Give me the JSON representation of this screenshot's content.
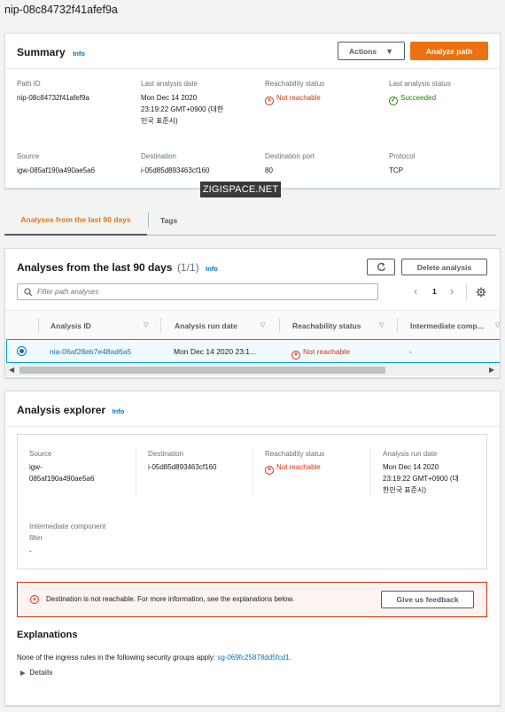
{
  "page_title": "nip-08c84732f41afef9a",
  "summary": {
    "title": "Summary",
    "info": "Info",
    "actions_label": "Actions",
    "analyze_label": "Analyze path",
    "path_id_label": "Path ID",
    "path_id": "nip-08c84732f41afef9a",
    "last_date_label": "Last analysis date",
    "last_date_l1": "Mon Dec 14 2020",
    "last_date_l2": "23:19:22 GMT+0900 (대한",
    "last_date_l3": "민국 표준시)",
    "reach_label": "Reachability status",
    "reach_value": "Not reachable",
    "last_status_label": "Last analysis status",
    "last_status_value": "Succeeded",
    "source_label": "Source",
    "source_value": "igw-085af190a490ae5a6",
    "dest_label": "Destination",
    "dest_value": "i-05d85d893463cf160",
    "port_label": "Destination port",
    "port_value": "80",
    "protocol_label": "Protocol",
    "protocol_value": "TCP"
  },
  "watermark": "ZIGISPACE.NET",
  "tabs": [
    "Analyses from the last 90 days",
    "Tags"
  ],
  "analyses": {
    "title": "Analyses from the last 90 days",
    "count": "(1/1)",
    "info": "Info",
    "delete_label": "Delete analysis",
    "filter_placeholder": "Filter path analyses",
    "page_number": "1",
    "columns": [
      "Analysis ID",
      "Analysis run date",
      "Reachability status",
      "Intermediate comp..."
    ],
    "row": {
      "id": "nia-06af28eb7e48ad6a5",
      "date": "Mon Dec 14 2020 23:1...",
      "status": "Not reachable",
      "intermediate": "-"
    }
  },
  "explorer": {
    "title": "Analysis explorer",
    "info": "Info",
    "source_label": "Source",
    "source_l1": "igw-",
    "source_l2": "085af190a490ae5a6",
    "dest_label": "Destination",
    "dest_value": "i-05d85d893463cf160",
    "reach_label": "Reachability status",
    "reach_value": "Not reachable",
    "run_label": "Analysis run date",
    "run_l1": "Mon Dec 14 2020",
    "run_l2": "23:19:22 GMT+0900 (대",
    "run_l3": "한민국 표준시)",
    "inter_label_l1": "Intermediate component",
    "inter_label_l2": "filter",
    "inter_value": "-",
    "alert_text": "Destination is not reachable. For more information, see the explanations below.",
    "feedback_label": "Give us feedback",
    "explanations_title": "Explanations",
    "explanation_text": "None of the ingress rules in the following security groups apply: ",
    "explanation_link": "sg-069fc25878dd5fcd1",
    "explanation_end": ".",
    "details_label": "Details"
  }
}
